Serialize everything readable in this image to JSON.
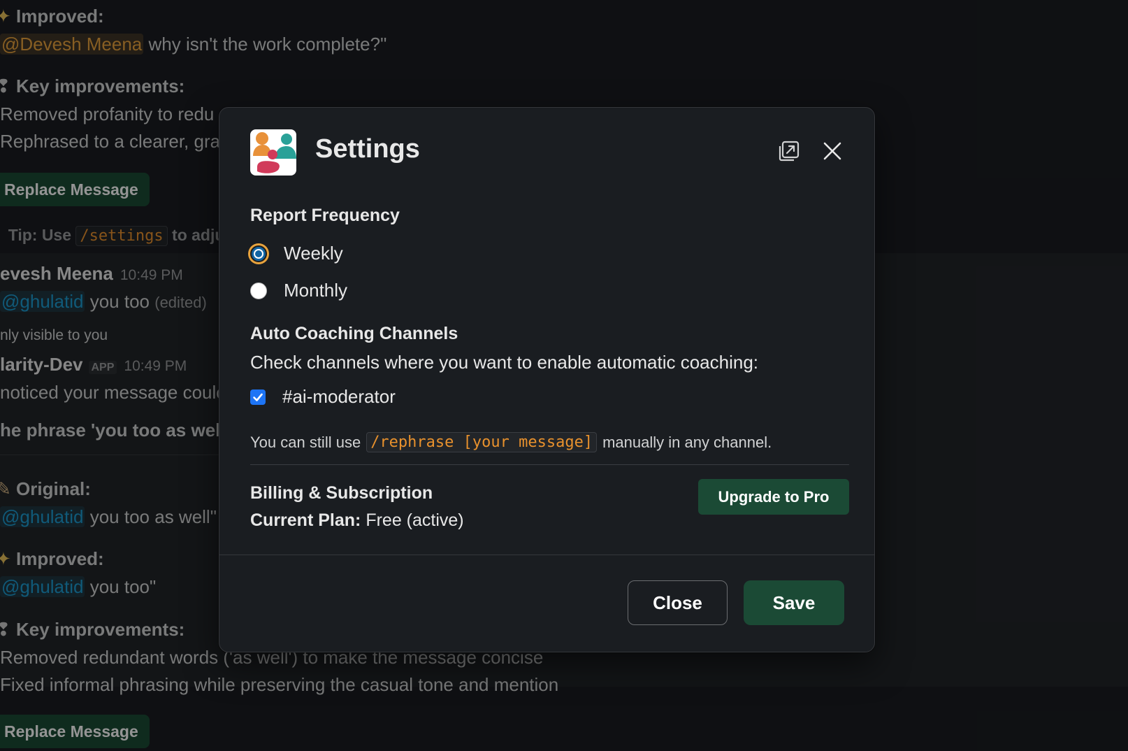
{
  "background": {
    "improved_label_1": "Improved:",
    "improved_mention_1": "@Devesh Meena",
    "improved_text_1": "why isn't the work complete?\"",
    "key_improvements_label_1": "Key improvements:",
    "key_item_1a": "Removed profanity to redu",
    "key_item_1b": "Rephrased to a clearer, gra",
    "replace_button_1": "Replace Message",
    "tip_prefix": "Tip: Use",
    "tip_code": "/settings",
    "tip_suffix": "to adjus",
    "msg1_author": "evesh Meena",
    "msg1_time": "10:49 PM",
    "msg1_mention": "@ghulatid",
    "msg1_text": "you too",
    "msg1_edited": "(edited)",
    "only_visible": "nly visible to you",
    "msg2_author": "larity-Dev",
    "msg2_app_tag": "APP",
    "msg2_time": "10:49 PM",
    "msg2_text": "noticed your message coulc",
    "msg2_phrase": "he phrase 'you too as well'",
    "original_label": "Original:",
    "original_mention": "@ghulatid",
    "original_text": "you too as well\"",
    "improved_label_2": "Improved:",
    "improved_mention_2": "@ghulatid",
    "improved_text_2": "you too\"",
    "key_improvements_label_2": "Key improvements:",
    "key_item_2a": "Removed redundant words ('as well') to make the message concise",
    "key_item_2b": "Fixed informal phrasing while preserving the casual tone and mention",
    "replace_button_2": "Replace Message"
  },
  "modal": {
    "title": "Settings",
    "report_frequency": {
      "label": "Report Frequency",
      "options": [
        "Weekly",
        "Monthly"
      ],
      "selected": "Weekly"
    },
    "auto_coaching": {
      "label": "Auto Coaching Channels",
      "description": "Check channels where you want to enable automatic coaching:",
      "channels": [
        {
          "name": "#ai-moderator",
          "checked": true
        }
      ]
    },
    "note": {
      "prefix": "You can still use",
      "code": "/rephrase [your message]",
      "suffix": "manually in any channel."
    },
    "billing": {
      "label": "Billing & Subscription",
      "plan_label": "Current Plan:",
      "plan_value": "Free (active)",
      "upgrade_button": "Upgrade to Pro"
    },
    "footer": {
      "close_button": "Close",
      "save_button": "Save"
    }
  },
  "colors": {
    "background": "#1a1d21",
    "primary_button": "#1b4a35",
    "mention_blue": "#1d9bd1",
    "mention_yellow": "#e8a33d",
    "code_orange": "#e8912d",
    "checkbox_blue": "#1d74f5"
  }
}
